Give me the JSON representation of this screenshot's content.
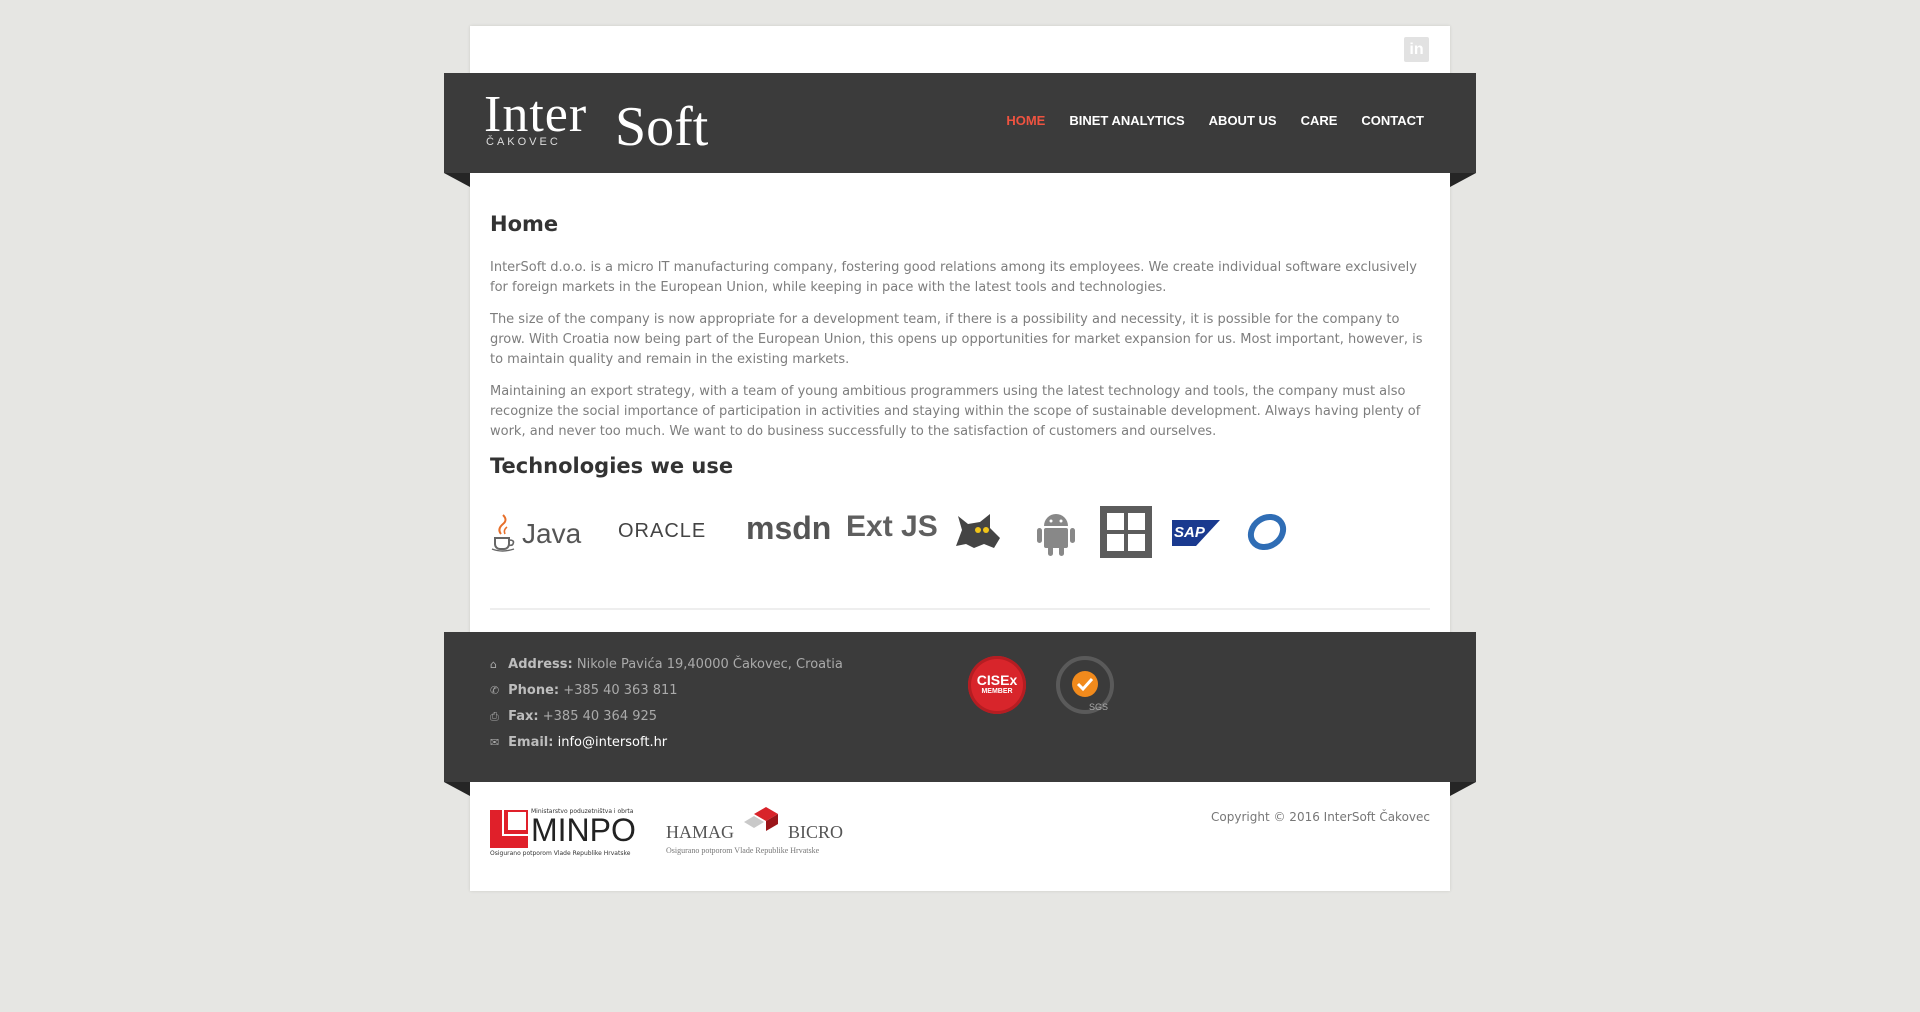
{
  "header": {
    "logo_main": "Inter",
    "logo_second": "Soft",
    "logo_city": "ČAKOVEC",
    "social_icon": "linkedin-icon",
    "social_label": "in"
  },
  "nav": {
    "items": [
      {
        "label": "HOME",
        "active": true
      },
      {
        "label": "BINET ANALYTICS",
        "active": false
      },
      {
        "label": "ABOUT US",
        "active": false
      },
      {
        "label": "CARE",
        "active": false
      },
      {
        "label": "CONTACT",
        "active": false
      }
    ]
  },
  "main": {
    "title": "Home",
    "paragraphs": [
      "InterSoft d.o.o. is a micro IT manufacturing company, fostering good relations among its employees. We create individual software exclusively for foreign markets in the European Union, while keeping in pace with the latest tools and technologies.",
      "The size of the company is now appropriate for a development team, if there is a possibility and necessity, it is possible for the company to grow. With Croatia now being part of the European Union, this opens up opportunities for market expansion for us. Most important, however, is to maintain quality and remain in the existing markets.",
      "Maintaining an export strategy, with a team of young ambitious programmers using the latest technology and tools, the company must also recognize the social importance of participation in activities and staying within the scope of sustainable development. Always having plenty of work, and never too much. We want to do business successfully to the satisfaction of customers and ourselves."
    ],
    "tech_title": "Technologies we use",
    "tech_logos": {
      "java": "Java",
      "oracle": "ORACLE",
      "msdn": "msdn",
      "extjs": "Ext JS",
      "tomcat": "tomcat-icon",
      "android": "android-icon",
      "windows": "windows-icon",
      "sap": "SAP",
      "eclipse_ring": "ring-logo-icon"
    }
  },
  "footer": {
    "address_label": "Address:",
    "address_value": "Nikole Pavića 19,40000 Čakovec, Croatia",
    "phone_label": "Phone:",
    "phone_value": "+385 40 363 811",
    "fax_label": "Fax:",
    "fax_value": "+385 40 364 925",
    "email_label": "Email:",
    "email_value": "info@intersoft.hr",
    "cisex_line1": "CISEx",
    "cisex_line2": "MEMBER",
    "iso_label": "SGS"
  },
  "bottom": {
    "minpo_name": "MINPO",
    "minpo_top": "Ministarstvo poduzetništva i obrta",
    "minpo_sub": "Osigurano potporom Vlade Republike Hrvatske",
    "hamag_name_left": "HAMAG",
    "hamag_name_right": "BICRO",
    "hamag_sub": "Osigurano potporom Vlade Republike Hrvatske",
    "copyright": "Copyright © 2016 InterSoft Čakovec"
  },
  "colors": {
    "band": "#3b3b3b",
    "accent": "#ef5340",
    "background": "#e6e6e3"
  }
}
